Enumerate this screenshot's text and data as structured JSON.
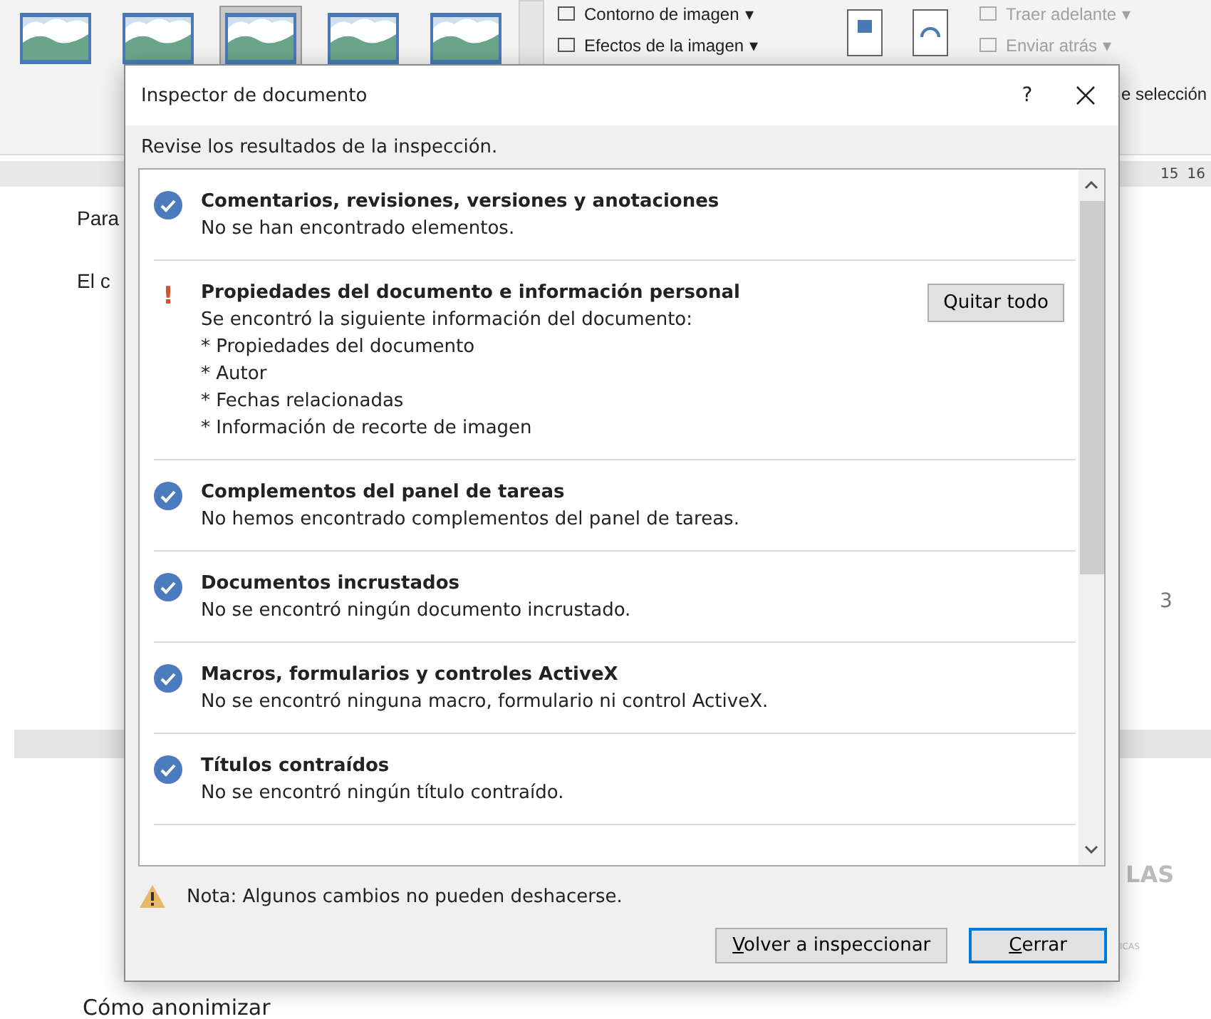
{
  "ribbon": {
    "picture_styles": [
      {
        "selected": false
      },
      {
        "selected": false
      },
      {
        "selected": true
      },
      {
        "selected": false
      },
      {
        "selected": false
      }
    ],
    "commands": [
      {
        "label": "Contorno de imagen",
        "caret": "▾",
        "disabled": false
      },
      {
        "label": "Efectos de la imagen",
        "caret": "▾",
        "disabled": false
      },
      {
        "label": "Traer adelante",
        "caret": "▾",
        "disabled": true
      },
      {
        "label": "Enviar atrás",
        "caret": "▾",
        "disabled": true
      }
    ],
    "cut_label": "e selección"
  },
  "ruler": {
    "labels": [
      "15",
      "16"
    ]
  },
  "document": {
    "lines": [
      "Para",
      "El c"
    ],
    "page_number": "3",
    "heading": "LAS",
    "subheading": "ICAS",
    "footer_text": "Cómo anonimizar"
  },
  "dialog": {
    "title": "Inspector de documento",
    "help": "?",
    "subtitle": "Revise los resultados de la inspección.",
    "results": [
      {
        "kind": "ok",
        "title": "Comentarios, revisiones, versiones y anotaciones",
        "description": "No se han encontrado elementos."
      },
      {
        "kind": "issue",
        "mark": "!",
        "title": "Propiedades del documento e información personal",
        "description": "Se encontró la siguiente información del documento:",
        "details": [
          "* Propiedades del documento",
          "* Autor",
          "* Fechas relacionadas",
          "* Información de recorte de imagen"
        ],
        "button": "Quitar todo"
      },
      {
        "kind": "ok",
        "title": "Complementos del panel de tareas",
        "description": "No hemos encontrado complementos del panel de tareas."
      },
      {
        "kind": "ok",
        "title": "Documentos incrustados",
        "description": "No se encontró ningún documento incrustado."
      },
      {
        "kind": "ok",
        "title": "Macros, formularios y controles ActiveX",
        "description": "No se encontró ninguna macro, formulario ni control ActiveX."
      },
      {
        "kind": "ok",
        "title": "Títulos contraídos",
        "description": "No se encontró ningún título contraído."
      }
    ],
    "note": "Nota: Algunos cambios no pueden deshacerse.",
    "buttons": [
      {
        "label": "Volver a inspeccionar",
        "default": false
      },
      {
        "label": "Cerrar",
        "default": true
      }
    ]
  }
}
